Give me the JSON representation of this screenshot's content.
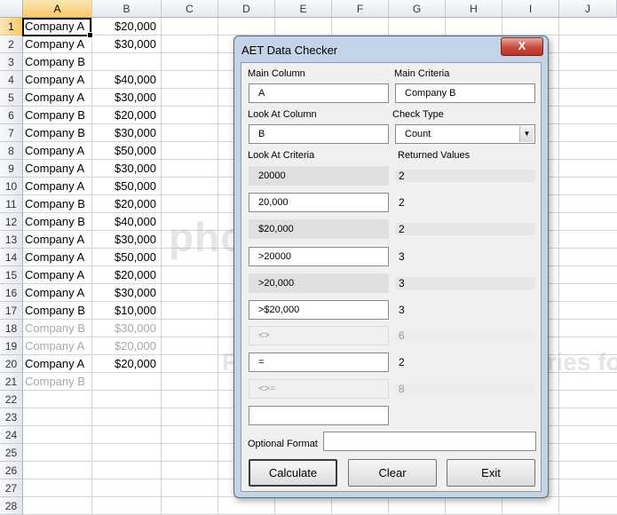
{
  "sheet": {
    "columns": [
      "A",
      "B",
      "C",
      "D",
      "E",
      "F",
      "G",
      "H",
      "I",
      "J"
    ],
    "rows": [
      "1",
      "2",
      "3",
      "4",
      "5",
      "6",
      "7",
      "8",
      "9",
      "10",
      "11",
      "12",
      "13",
      "14",
      "15",
      "16",
      "17",
      "18",
      "19",
      "20",
      "21",
      "22",
      "23",
      "24",
      "25",
      "26",
      "27",
      "28"
    ],
    "colA": [
      "Company A",
      "Company A",
      "Company B",
      "Company A",
      "Company A",
      "Company B",
      "Company B",
      "Company A",
      "Company A",
      "Company A",
      "Company B",
      "Company B",
      "Company A",
      "Company A",
      "Company A",
      "Company A",
      "Company B",
      "Company B",
      "Company A",
      "Company A",
      "Company B"
    ],
    "colB": [
      "$20,000",
      "$30,000",
      "",
      "$40,000",
      "$30,000",
      "$20,000",
      "$30,000",
      "$50,000",
      "$30,000",
      "$50,000",
      "$20,000",
      "$40,000",
      "$30,000",
      "$50,000",
      "$20,000",
      "$30,000",
      "$10,000",
      "$30,000",
      "$20,000",
      "$20,000",
      ""
    ]
  },
  "watermark": {
    "text": "photobucket",
    "text2": "Protect more of your memories for less!"
  },
  "dialog": {
    "title": "AET Data Checker",
    "close_label": "X",
    "main_column_label": "Main Column",
    "main_column_value": "A",
    "main_criteria_label": "Main Criteria",
    "main_criteria_value": "Company B",
    "look_at_column_label": "Look At Column",
    "look_at_column_value": "B",
    "check_type_label": "Check Type",
    "check_type_value": "Count",
    "look_at_criteria_label": "Look At Criteria",
    "returned_values_label": "Returned Values",
    "criteria": [
      "20000",
      "20,000",
      "$20,000",
      ">20000",
      ">20,000",
      ">$20,000",
      "<>",
      "=",
      "<>=",
      ""
    ],
    "returned": [
      "2",
      "2",
      "2",
      "3",
      "3",
      "3",
      "6",
      "2",
      "8",
      ""
    ],
    "optional_format_label": "Optional Format",
    "optional_format_value": "",
    "calculate_label": "Calculate",
    "clear_label": "Clear",
    "exit_label": "Exit"
  }
}
